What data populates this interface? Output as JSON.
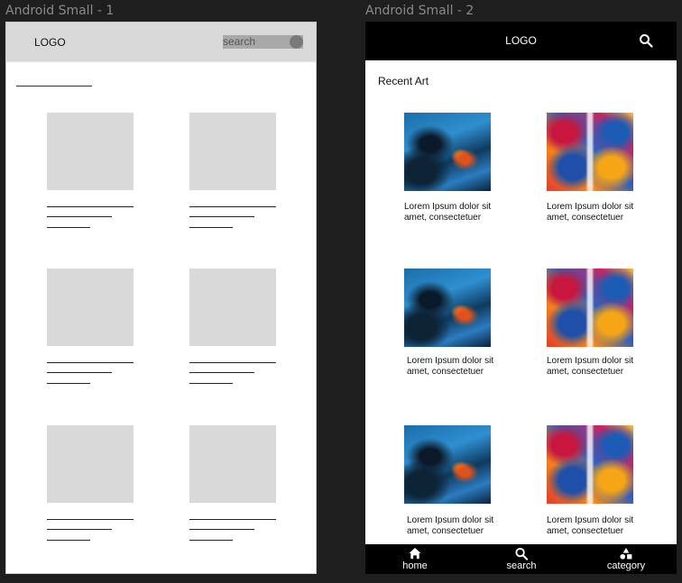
{
  "frames": {
    "frame1_title": "Android Small - 1",
    "frame2_title": "Android Small - 2"
  },
  "wireframe": {
    "logo": "LOGO",
    "search_placeholder": "search"
  },
  "design": {
    "logo": "LOGO",
    "section_title": "Recent Art",
    "cards": [
      {
        "art": "abstract-blue-painting",
        "caption": "Lorem Ipsum dolor sit amet, consectetuer"
      },
      {
        "art": "abstract-colorful-painting",
        "caption": "Lorem Ipsum dolor sit amet, consectetuer"
      },
      {
        "art": "abstract-blue-painting",
        "caption": "Lorem Ipsum dolor sit amet, consectetuer"
      },
      {
        "art": "abstract-colorful-painting",
        "caption": "Lorem Ipsum dolor sit amet, consectetuer"
      },
      {
        "art": "abstract-blue-painting",
        "caption": "Lorem Ipsum dolor sit amet, consectetuer"
      },
      {
        "art": "abstract-colorful-painting",
        "caption": "Lorem Ipsum dolor sit amet, consectetuer"
      }
    ],
    "nav": {
      "home": "home",
      "search": "search",
      "category": "category"
    }
  },
  "colors": {
    "canvas_bg": "#1e1e1e",
    "wireframe_placeholder": "#d9d9d9",
    "header_dark": "#000000"
  }
}
